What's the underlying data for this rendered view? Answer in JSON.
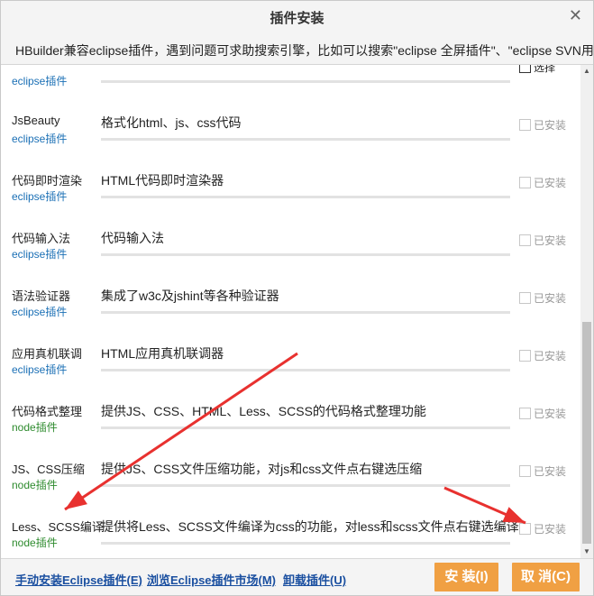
{
  "dialog": {
    "title": "插件安装",
    "close": "✕",
    "notice": "HBuilder兼容eclipse插件，遇到问题可求助搜索引擎，比如可以搜索\"eclipse 全屏插件\"、\"eclipse SVN用法\""
  },
  "plugins": [
    {
      "name": "",
      "type": "eclipse插件",
      "desc": "",
      "check": "选择",
      "active": true
    },
    {
      "name": "JsBeauty",
      "type": "eclipse插件",
      "desc": "格式化html、js、css代码",
      "check": "已安装"
    },
    {
      "name": "代码即时渲染",
      "type": "eclipse插件",
      "desc": "HTML代码即时渲染器",
      "check": "已安装"
    },
    {
      "name": "代码输入法",
      "type": "eclipse插件",
      "desc": "代码输入法",
      "check": "已安装"
    },
    {
      "name": "语法验证器",
      "type": "eclipse插件",
      "desc": "集成了w3c及jshint等各种验证器",
      "check": "已安装"
    },
    {
      "name": "应用真机联调",
      "type": "eclipse插件",
      "desc": "HTML应用真机联调器",
      "check": "已安装"
    },
    {
      "name": "代码格式整理",
      "type": "node插件",
      "desc": "提供JS、CSS、HTML、Less、SCSS的代码格式整理功能",
      "check": "已安装"
    },
    {
      "name": "JS、CSS压缩",
      "type": "node插件",
      "desc": "提供JS、CSS文件压缩功能，对js和css文件点右键选压缩",
      "check": "已安装"
    },
    {
      "name": "Less、SCSS编译",
      "type": "node插件",
      "desc": "提供将Less、SCSS文件编译为css的功能，对less和scss文件点右键选编译",
      "check": "已安装"
    }
  ],
  "scrollbar": {
    "up": "▲",
    "down": "▼"
  },
  "footer": {
    "manual": "手动安装Eclipse插件(E)",
    "market": "浏览Eclipse插件市场(M)",
    "uninstall": "卸载插件(U)",
    "install": "安 装(I)",
    "cancel": "取 消(C)"
  },
  "colors": {
    "arrow": "#e8312f",
    "button": "#f0a043",
    "eclipse": "#1a6fb5",
    "node": "#2e8b2e",
    "link": "#1a4fa0"
  }
}
